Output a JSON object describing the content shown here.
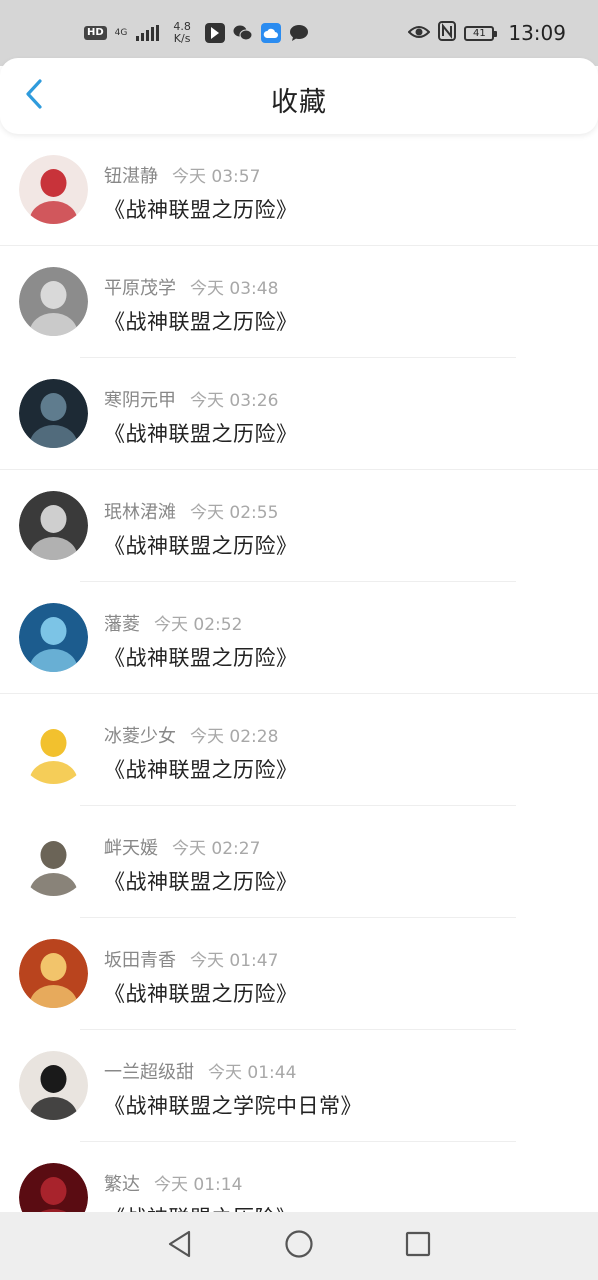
{
  "status_bar": {
    "hd": "HD",
    "net_type": "4G",
    "net_sub": "",
    "speed_value": "4.8",
    "speed_unit": "K/s",
    "battery": "41",
    "time": "13:09",
    "icons": [
      "hd-icon",
      "signal-icon",
      "app-icon",
      "wechat-icon",
      "cloud-icon",
      "message-icon",
      "eye-icon",
      "nfc-icon",
      "battery-icon"
    ]
  },
  "header": {
    "title": "收藏",
    "back_icon": "chevron-left-icon",
    "accent": "#2f9bdc"
  },
  "favorites": [
    {
      "name": "钮湛静",
      "time": "今天 03:57",
      "work": "《战神联盟之历险》",
      "avatar_bg": "#f2e7e4",
      "avatar_fg": "#c8333a"
    },
    {
      "name": "平原茂学",
      "time": "今天 03:48",
      "work": "《战神联盟之历险》",
      "avatar_bg": "#8c8c8c",
      "avatar_fg": "#d9d9d9"
    },
    {
      "name": "寒阴元甲",
      "time": "今天 03:26",
      "work": "《战神联盟之历险》",
      "avatar_bg": "#1d2a35",
      "avatar_fg": "#5f7c8e"
    },
    {
      "name": "珉林涒滩",
      "time": "今天 02:55",
      "work": "《战神联盟之历险》",
      "avatar_bg": "#3a3a3a",
      "avatar_fg": "#cfcfcf"
    },
    {
      "name": "藩菱",
      "time": "今天 02:52",
      "work": "《战神联盟之历险》",
      "avatar_bg": "#1c5c8e",
      "avatar_fg": "#7cc4e6"
    },
    {
      "name": "冰菱少女",
      "time": "今天 02:28",
      "work": "《战神联盟之历险》",
      "avatar_bg": "#ffffff",
      "avatar_fg": "#f2c12e"
    },
    {
      "name": "衅天媛",
      "time": "今天 02:27",
      "work": "《战神联盟之历险》",
      "avatar_bg": "#ffffff",
      "avatar_fg": "#6b6457"
    },
    {
      "name": "坂田青香",
      "time": "今天 01:47",
      "work": "《战神联盟之历险》",
      "avatar_bg": "#b9441e",
      "avatar_fg": "#f2c46b"
    },
    {
      "name": "一兰超级甜",
      "time": "今天 01:44",
      "work": "《战神联盟之学院中日常》",
      "avatar_bg": "#e9e4df",
      "avatar_fg": "#1a1a1a"
    },
    {
      "name": "繁达",
      "time": "今天 01:14",
      "work": "《战神联盟之历险》",
      "avatar_bg": "#5a0c12",
      "avatar_fg": "#a8232c"
    }
  ],
  "nav_bar": {
    "icons": [
      "back-triangle-icon",
      "home-circle-icon",
      "recents-square-icon"
    ]
  }
}
